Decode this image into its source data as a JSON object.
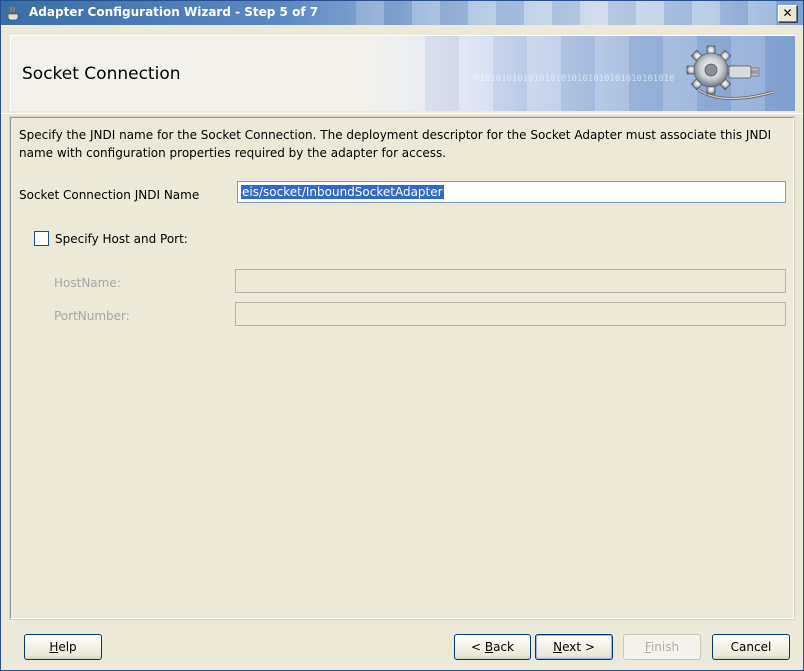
{
  "window": {
    "title": "Adapter Configuration Wizard - Step 5 of 7",
    "close_glyph": "✕"
  },
  "banner": {
    "title": "Socket Connection",
    "binary": "0101010101010101010101010101010101010"
  },
  "main": {
    "description": "Specify the JNDI name for the Socket Connection.  The deployment descriptor for the Socket Adapter must associate this JNDI name with configuration properties required by the adapter for access.",
    "jndi": {
      "label_pre": "Socket Connection ",
      "label_mnemonic": "J",
      "label_post": "NDI Name",
      "value": "eis/socket/InboundSocketAdapter"
    },
    "host_port_checkbox": {
      "label": "Specify Host and Port:",
      "checked": false
    },
    "hostname": {
      "label": "HostName:",
      "value": ""
    },
    "portnumber": {
      "label": "PortNumber:",
      "value": ""
    }
  },
  "footer": {
    "help": {
      "mnemonic": "H",
      "rest": "elp"
    },
    "back": {
      "pre": "< ",
      "mnemonic": "B",
      "rest": "ack"
    },
    "next": {
      "mnemonic": "N",
      "rest": "ext >"
    },
    "finish": {
      "mnemonic": "F",
      "rest": "inish"
    },
    "cancel": "Cancel"
  },
  "colors": {
    "selection": "#316ac5",
    "window_bg": "#ece9d8",
    "title_bar": "#3a6ea5"
  }
}
